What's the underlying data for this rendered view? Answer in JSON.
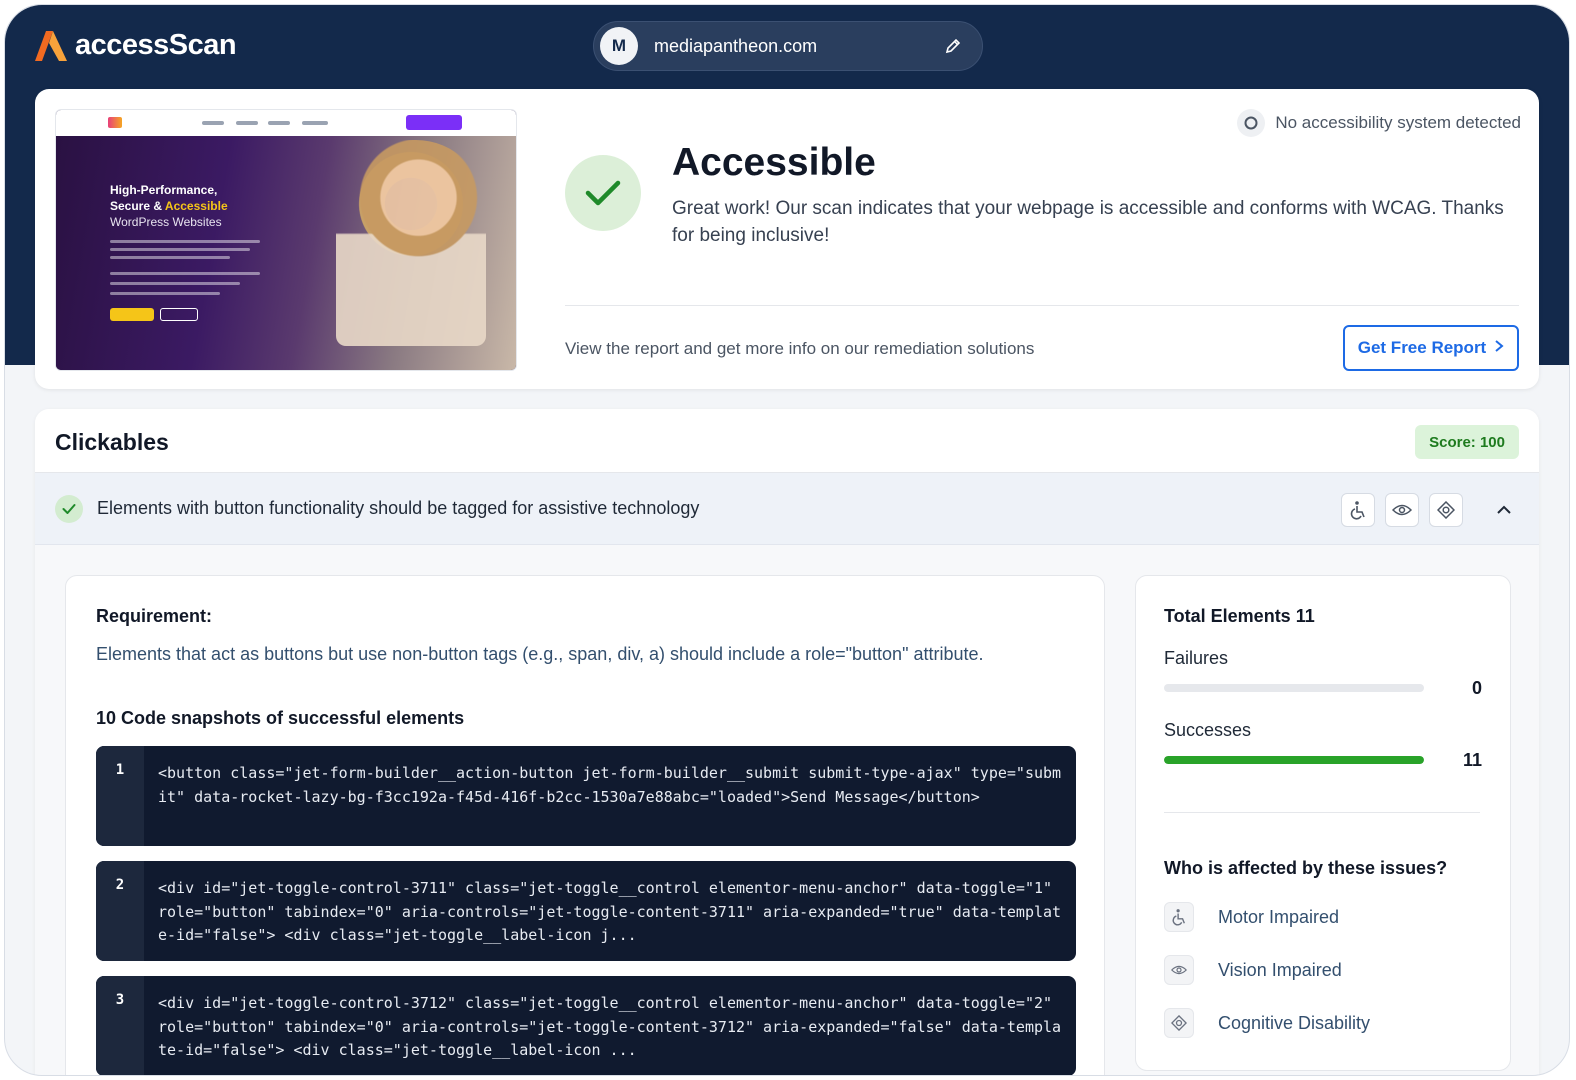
{
  "header": {
    "brand": "accessScan",
    "site_initial": "M",
    "site_url": "mediapantheon.com"
  },
  "thumbnail": {
    "headline_1": "High-Performance,",
    "headline_2a": "Secure & ",
    "headline_2b": "Accessible",
    "headline_3": "WordPress Websites"
  },
  "summary": {
    "status_title": "Accessible",
    "status_description": "Great work! Our scan indicates that your webpage is accessible and conforms with WCAG. Thanks for being inclusive!",
    "no_system": "No accessibility system detected",
    "report_text": "View the report and get more info on our remediation solutions",
    "report_button": "Get Free Report"
  },
  "clickables": {
    "title": "Clickables",
    "score": "Score: 100",
    "rule_text": "Elements with button functionality should be tagged for assistive technology",
    "requirement_label": "Requirement:",
    "requirement_text": "Elements that act as buttons but use non-button tags (e.g., span, div, a) should include a role=\"button\" attribute.",
    "snapshots_title": "10 Code snapshots of successful elements",
    "snapshots": [
      {
        "num": "1",
        "code": "<button class=\"jet-form-builder__action-button jet-form-builder__submit submit-type-ajax\" type=\"submit\" data-rocket-lazy-bg-f3cc192a-f45d-416f-b2cc-1530a7e88abc=\"loaded\">Send Message</button>"
      },
      {
        "num": "2",
        "code": "<div id=\"jet-toggle-control-3711\" class=\"jet-toggle__control elementor-menu-anchor\" data-toggle=\"1\" role=\"button\" tabindex=\"0\" aria-controls=\"jet-toggle-content-3711\" aria-expanded=\"true\" data-template-id=\"false\"> <div class=\"jet-toggle__label-icon j..."
      },
      {
        "num": "3",
        "code": "<div id=\"jet-toggle-control-3712\" class=\"jet-toggle__control elementor-menu-anchor\" data-toggle=\"2\" role=\"button\" tabindex=\"0\" aria-controls=\"jet-toggle-content-3712\" aria-expanded=\"false\" data-template-id=\"false\"> <div class=\"jet-toggle__label-icon ..."
      }
    ]
  },
  "stats": {
    "total_label": "Total Elements 11",
    "failures_label": "Failures",
    "failures_value": "0",
    "failures_fraction": 0,
    "successes_label": "Successes",
    "successes_value": "11",
    "successes_fraction": 1,
    "who_title": "Who is affected by these issues?",
    "affected": [
      "Motor Impaired",
      "Vision Impaired",
      "Cognitive Disability"
    ]
  },
  "colors": {
    "navy": "#13294b",
    "brand_orange": "#f26a21",
    "success_green": "#29a329",
    "link_blue": "#1d6ae5"
  },
  "icons": [
    "accessscan-logo",
    "edit-icon",
    "checkmark-icon",
    "no-system-icon",
    "chevron-right-icon",
    "wheelchair-icon",
    "eye-icon",
    "brain-icon",
    "chevron-up-icon"
  ]
}
